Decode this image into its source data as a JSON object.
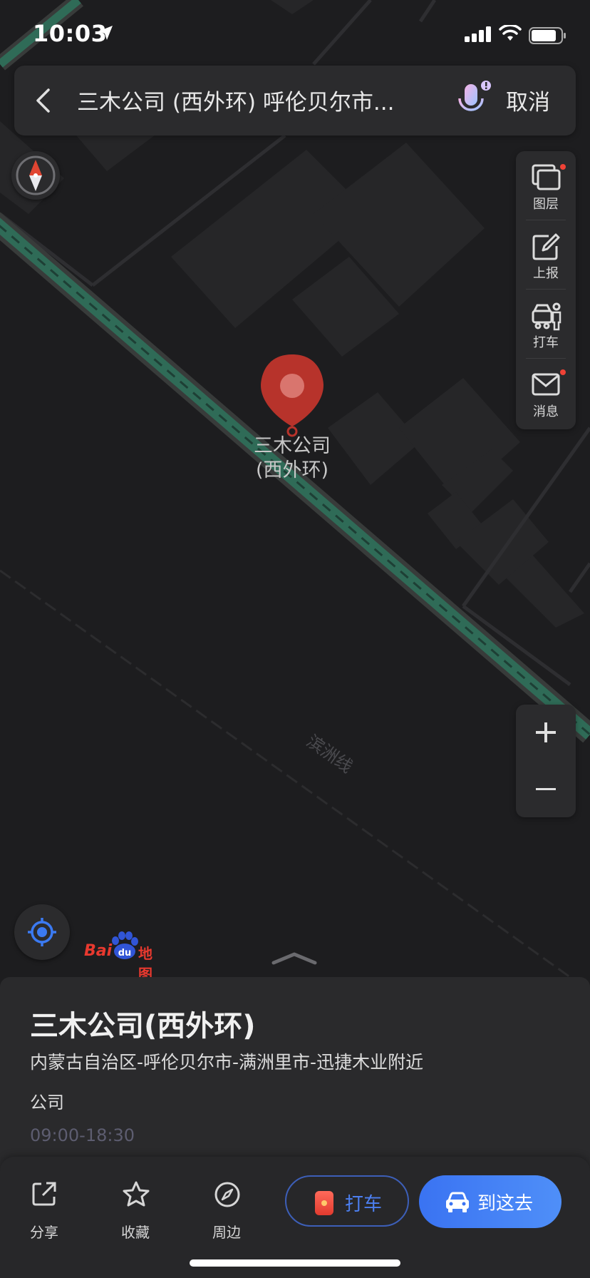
{
  "status_bar": {
    "time": "10:03"
  },
  "search": {
    "query": "三木公司 (西外环) 呼伦贝尔市...",
    "cancel_label": "取消"
  },
  "map": {
    "marker_label_line1": "三木公司",
    "marker_label_line2": "(西外环)",
    "rail_label": "滨洲线",
    "logo_bai": "Bai",
    "logo_du": "du",
    "logo_ditu": "地图"
  },
  "tools": [
    {
      "label": "图层",
      "icon": "layers-icon"
    },
    {
      "label": "上报",
      "icon": "report-edit-icon"
    },
    {
      "label": "打车",
      "icon": "taxi-person-icon"
    },
    {
      "label": "消息",
      "icon": "mail-icon"
    }
  ],
  "zoom": {
    "in_icon": "plus-icon",
    "out_icon": "minus-icon"
  },
  "place": {
    "name": "三木公司(西外环)",
    "address": "内蒙古自治区-呼伦贝尔市-满洲里市-迅捷木业附近",
    "category": "公司",
    "hours": "09:00-18:30"
  },
  "actions": {
    "share": "分享",
    "favorite": "收藏",
    "nearby": "周边",
    "taxi": "打车",
    "go": "到这去"
  },
  "colors": {
    "map_bg": "#1d1d1f",
    "panel_bg": "#2b2b2d",
    "accent_blue": "#3a73f2",
    "marker_red": "#b7332b",
    "notify_dot": "#f04236",
    "road_green": "#2f6b57"
  }
}
